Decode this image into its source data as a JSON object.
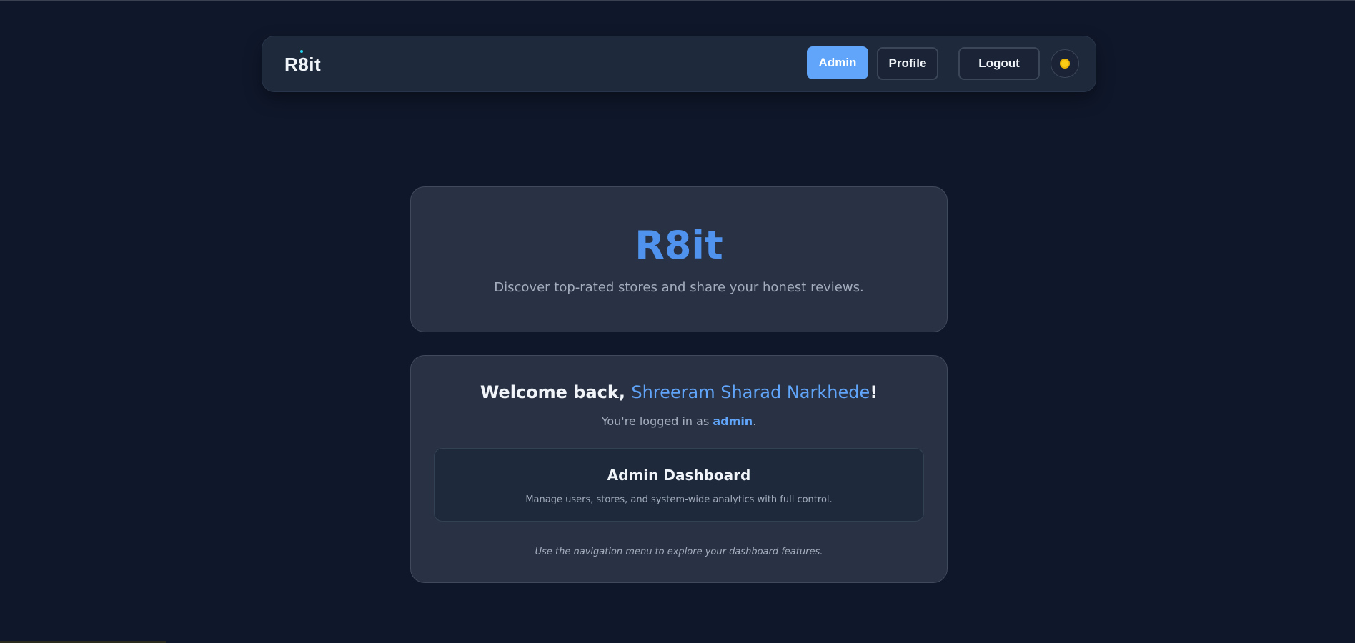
{
  "navbar": {
    "logo": "R8it",
    "admin_label": "Admin",
    "profile_label": "Profile",
    "logout_label": "Logout",
    "theme_icon": "sun-icon"
  },
  "hero": {
    "title": "R8it",
    "subtitle": "Discover top-rated stores and share your honest reviews."
  },
  "welcome": {
    "greeting_prefix": "Welcome back, ",
    "user_name": "Shreeram Sharad Narkhede",
    "greeting_suffix": "!",
    "role_prefix": "You're logged in as ",
    "role": "admin",
    "role_suffix": ".",
    "dashboard_title": "Admin Dashboard",
    "dashboard_desc": "Manage users, stores, and system-wide analytics with full control.",
    "hint": "Use the navigation menu to explore your dashboard features."
  },
  "colors": {
    "background": "#0f172a",
    "accent": "#60a5fa",
    "card": "#293244"
  }
}
